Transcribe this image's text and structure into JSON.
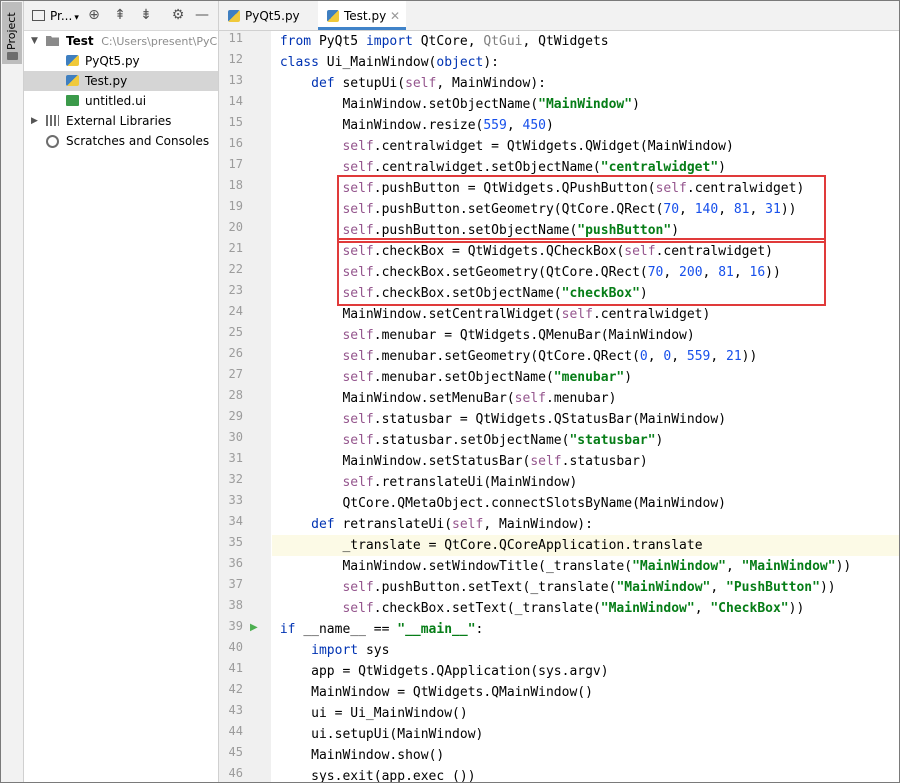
{
  "sidebar_tab": {
    "label": "Project"
  },
  "project_panel": {
    "title": "Pr...",
    "items": [
      {
        "name": "Test",
        "path": "C:\\Users\\present\\PyC"
      },
      {
        "name": "PyQt5.py"
      },
      {
        "name": "Test.py"
      },
      {
        "name": "untitled.ui"
      },
      {
        "name": "External Libraries"
      },
      {
        "name": "Scratches and Consoles"
      }
    ]
  },
  "editor_tabs": [
    {
      "label": "PyQt5.py"
    },
    {
      "label": "Test.py"
    }
  ],
  "code": {
    "line_numbers": [
      "11",
      "12",
      "13",
      "14",
      "15",
      "16",
      "17",
      "18",
      "19",
      "20",
      "21",
      "22",
      "23",
      "24",
      "25",
      "26",
      "27",
      "28",
      "29",
      "30",
      "31",
      "32",
      "33",
      "34",
      "35",
      "36",
      "37",
      "38",
      "39",
      "40",
      "41",
      "42",
      "43",
      "44",
      "45",
      "46"
    ],
    "lines": [
      "from PyQt5 import QtCore, QtGui, QtWidgets",
      "class Ui_MainWindow(object):",
      "    def setupUi(self, MainWindow):",
      "        MainWindow.setObjectName(\"MainWindow\")",
      "        MainWindow.resize(559, 450)",
      "        self.centralwidget = QtWidgets.QWidget(MainWindow)",
      "        self.centralwidget.setObjectName(\"centralwidget\")",
      "        self.pushButton = QtWidgets.QPushButton(self.centralwidget)",
      "        self.pushButton.setGeometry(QtCore.QRect(70, 140, 81, 31))",
      "        self.pushButton.setObjectName(\"pushButton\")",
      "        self.checkBox = QtWidgets.QCheckBox(self.centralwidget)",
      "        self.checkBox.setGeometry(QtCore.QRect(70, 200, 81, 16))",
      "        self.checkBox.setObjectName(\"checkBox\")",
      "        MainWindow.setCentralWidget(self.centralwidget)",
      "        self.menubar = QtWidgets.QMenuBar(MainWindow)",
      "        self.menubar.setGeometry(QtCore.QRect(0, 0, 559, 21))",
      "        self.menubar.setObjectName(\"menubar\")",
      "        MainWindow.setMenuBar(self.menubar)",
      "        self.statusbar = QtWidgets.QStatusBar(MainWindow)",
      "        self.statusbar.setObjectName(\"statusbar\")",
      "        MainWindow.setStatusBar(self.statusbar)",
      "        self.retranslateUi(MainWindow)",
      "        QtCore.QMetaObject.connectSlotsByName(MainWindow)",
      "    def retranslateUi(self, MainWindow):",
      "        _translate = QtCore.QCoreApplication.translate",
      "        MainWindow.setWindowTitle(_translate(\"MainWindow\", \"MainWindow\"))",
      "        self.pushButton.setText(_translate(\"MainWindow\", \"PushButton\"))",
      "        self.checkBox.setText(_translate(\"MainWindow\", \"CheckBox\"))",
      "if __name__ == \"__main__\":",
      "    import sys",
      "    app = QtWidgets.QApplication(sys.argv)",
      "    MainWindow = QtWidgets.QMainWindow()",
      "    ui = Ui_MainWindow()",
      "    ui.setupUi(MainWindow)",
      "    MainWindow.show()",
      "    sys.exit(app.exec_())"
    ],
    "current_line": "35",
    "run_line": "39"
  },
  "colors": {
    "highlight_box": "#e03a3a",
    "keyword": "#0033b3",
    "string": "#067d17",
    "number": "#1750eb",
    "self": "#94558d",
    "active_tab_underline": "#4083c9"
  }
}
